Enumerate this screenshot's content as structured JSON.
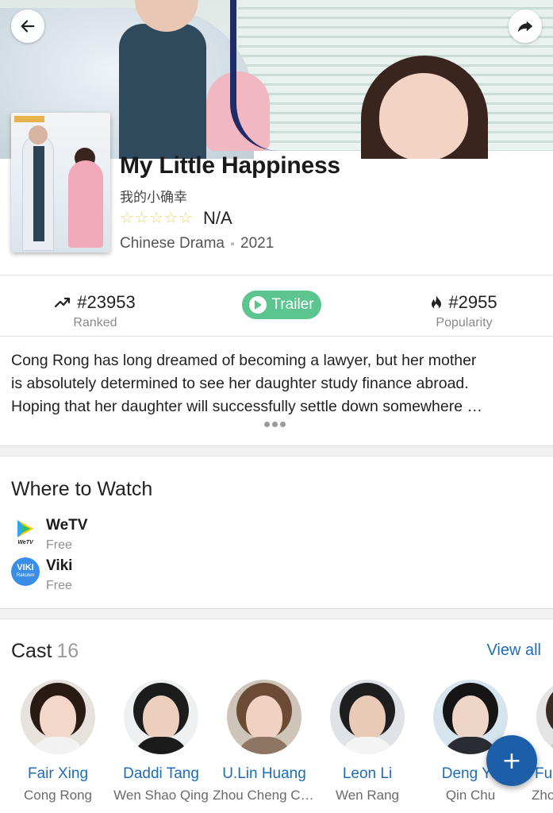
{
  "header": {
    "back_icon": "arrow-left-icon",
    "share_icon": "share-arrow-icon"
  },
  "show": {
    "title": "My Little Happiness",
    "native_title": "我的小确幸",
    "rating": "N/A",
    "stars_filled": 0,
    "stars_total": 5,
    "country_type": "Chinese Drama",
    "year": "2021"
  },
  "stats": {
    "ranked_value": "#23953",
    "ranked_label": "Ranked",
    "trailer_label": "Trailer",
    "popularity_value": "#2955",
    "popularity_label": "Popularity"
  },
  "synopsis": {
    "lines": [
      "Cong Rong has long dreamed of becoming a lawyer, but her mother",
      "is absolutely determined to see her daughter study finance abroad.",
      "Hoping that her daughter will successfully settle down somewhere …"
    ]
  },
  "where_to_watch": {
    "title": "Where to Watch",
    "services": [
      {
        "name": "WeTV",
        "price": "Free",
        "icon": "wetv-logo-icon",
        "icon_caption": "WeTV"
      },
      {
        "name": "Viki",
        "price": "Free",
        "icon": "viki-logo-icon",
        "icon_text": "VIKI",
        "icon_caption": "Rakuten"
      }
    ]
  },
  "cast": {
    "title": "Cast",
    "count": "16",
    "view_all": "View all",
    "members": [
      {
        "name": "Fair Xing",
        "role": "Cong Rong"
      },
      {
        "name": "Daddi Tang",
        "role": "Wen Shao Qing"
      },
      {
        "name": "U.Lin Huang",
        "role": "Zhou Cheng Cheng"
      },
      {
        "name": "Leon Li",
        "role": "Wen Rang"
      },
      {
        "name": "Deng Yu",
        "role": "Qin Chu"
      },
      {
        "name": "Fu",
        "role": "Zhou"
      }
    ]
  },
  "fab": {
    "label": "+",
    "icon": "plus-icon"
  },
  "colors": {
    "accent_blue": "#1e6db5",
    "trailer_green": "#5bc48f",
    "fab_blue": "#1c5fa8",
    "star_yellow": "#e7d46a"
  }
}
